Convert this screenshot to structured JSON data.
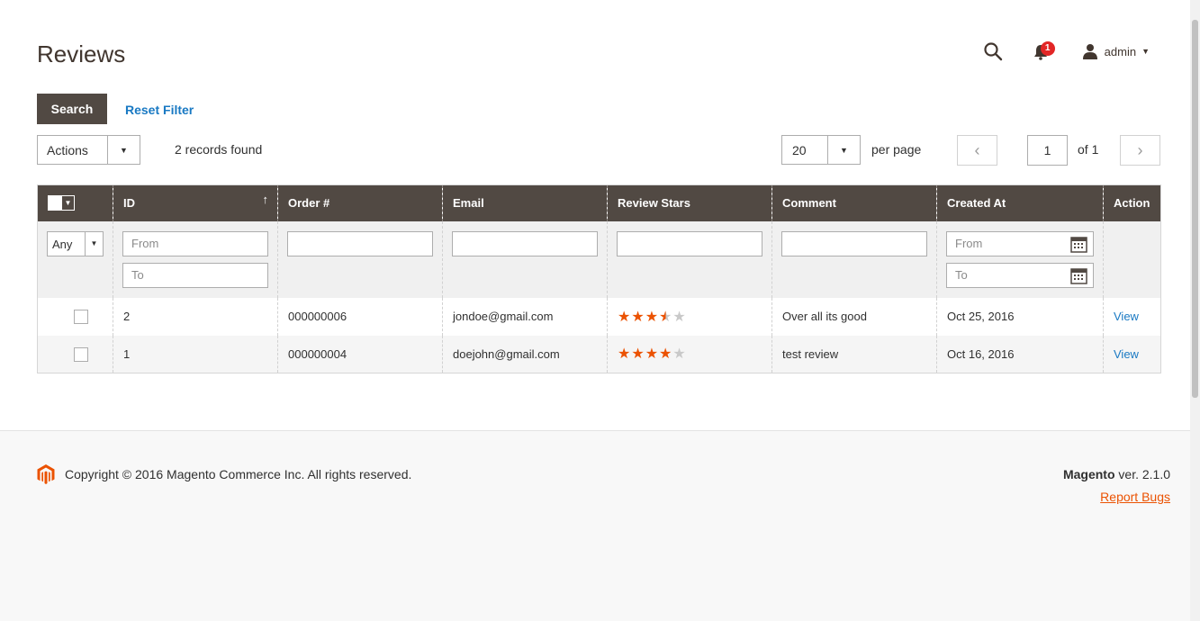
{
  "header": {
    "title": "Reviews",
    "notification_count": "1",
    "user_name": "admin"
  },
  "toolbar": {
    "search_label": "Search",
    "reset_label": "Reset Filter",
    "actions_label": "Actions",
    "records_found": "2 records found",
    "per_page_value": "20",
    "per_page_label": "per page",
    "current_page": "1",
    "of_pages": "of 1"
  },
  "table": {
    "columns": [
      "ID",
      "Order #",
      "Email",
      "Review Stars",
      "Comment",
      "Created At",
      "Action"
    ],
    "filters": {
      "any": "Any",
      "from": "From",
      "to": "To"
    },
    "rows": [
      {
        "id": "2",
        "order": "000000006",
        "email": "jondoe@gmail.com",
        "stars": 3.5,
        "comment": "Over all its good",
        "created": "Oct 25, 2016",
        "action": "View"
      },
      {
        "id": "1",
        "order": "000000004",
        "email": "doejohn@gmail.com",
        "stars": 4,
        "comment": "test review",
        "created": "Oct 16, 2016",
        "action": "View"
      }
    ]
  },
  "footer": {
    "copyright": "Copyright © 2016 Magento Commerce Inc. All rights reserved.",
    "brand": "Magento",
    "version": " ver. 2.1.0",
    "report_bugs": "Report Bugs"
  },
  "colors": {
    "header_bg": "#514943",
    "accent": "#eb5202",
    "link": "#1979c3"
  }
}
